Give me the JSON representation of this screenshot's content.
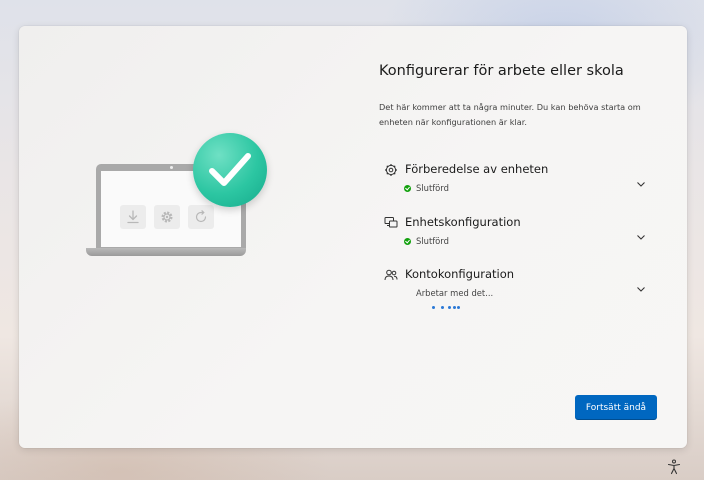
{
  "page": {
    "title": "Konfigurerar för arbete eller skola",
    "description": "Det här kommer att ta några minuter. Du kan behöva starta om enheten när konfigurationen är klar."
  },
  "steps": [
    {
      "icon": "gear-icon",
      "title": "Förberedelse av enheten",
      "status": "Slutförd",
      "state": "complete"
    },
    {
      "icon": "devices-icon",
      "title": "Enhetskonfiguration",
      "status": "Slutförd",
      "state": "complete"
    },
    {
      "icon": "people-icon",
      "title": "Kontokonfiguration",
      "status": "Arbetar med det...",
      "state": "in-progress"
    }
  ],
  "illustration": {
    "icons": [
      "download-icon",
      "gear-icon",
      "refresh-icon",
      "checkmark-icon"
    ]
  },
  "buttons": {
    "continue_label": "Fortsätt ändå"
  },
  "colors": {
    "accent": "#0067c0",
    "success": "#13a10e",
    "check_circle": "#2cc6a2",
    "progress_dots": "#2b79d6"
  }
}
